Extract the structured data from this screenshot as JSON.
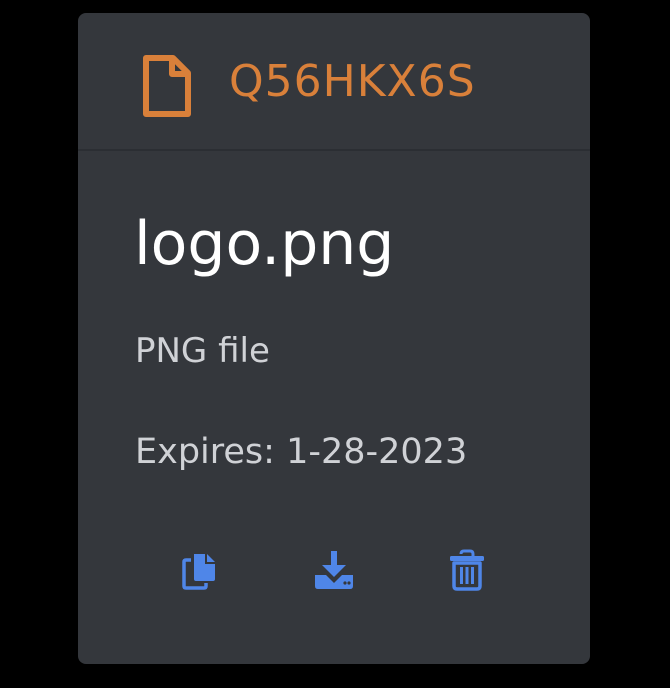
{
  "card": {
    "code": "Q56HKX6S",
    "filename": "logo.png",
    "filetype": "PNG file",
    "expires": "Expires: 1-28-2023"
  },
  "icons": {
    "header": "file-icon",
    "actions": [
      "copy-icon",
      "download-icon",
      "trash-icon"
    ]
  },
  "colors": {
    "background": "#000000",
    "card": "#34373c",
    "accent": "#d9803a",
    "action": "#4f86e8",
    "title": "#ffffff",
    "text": "#d0d2d6"
  }
}
